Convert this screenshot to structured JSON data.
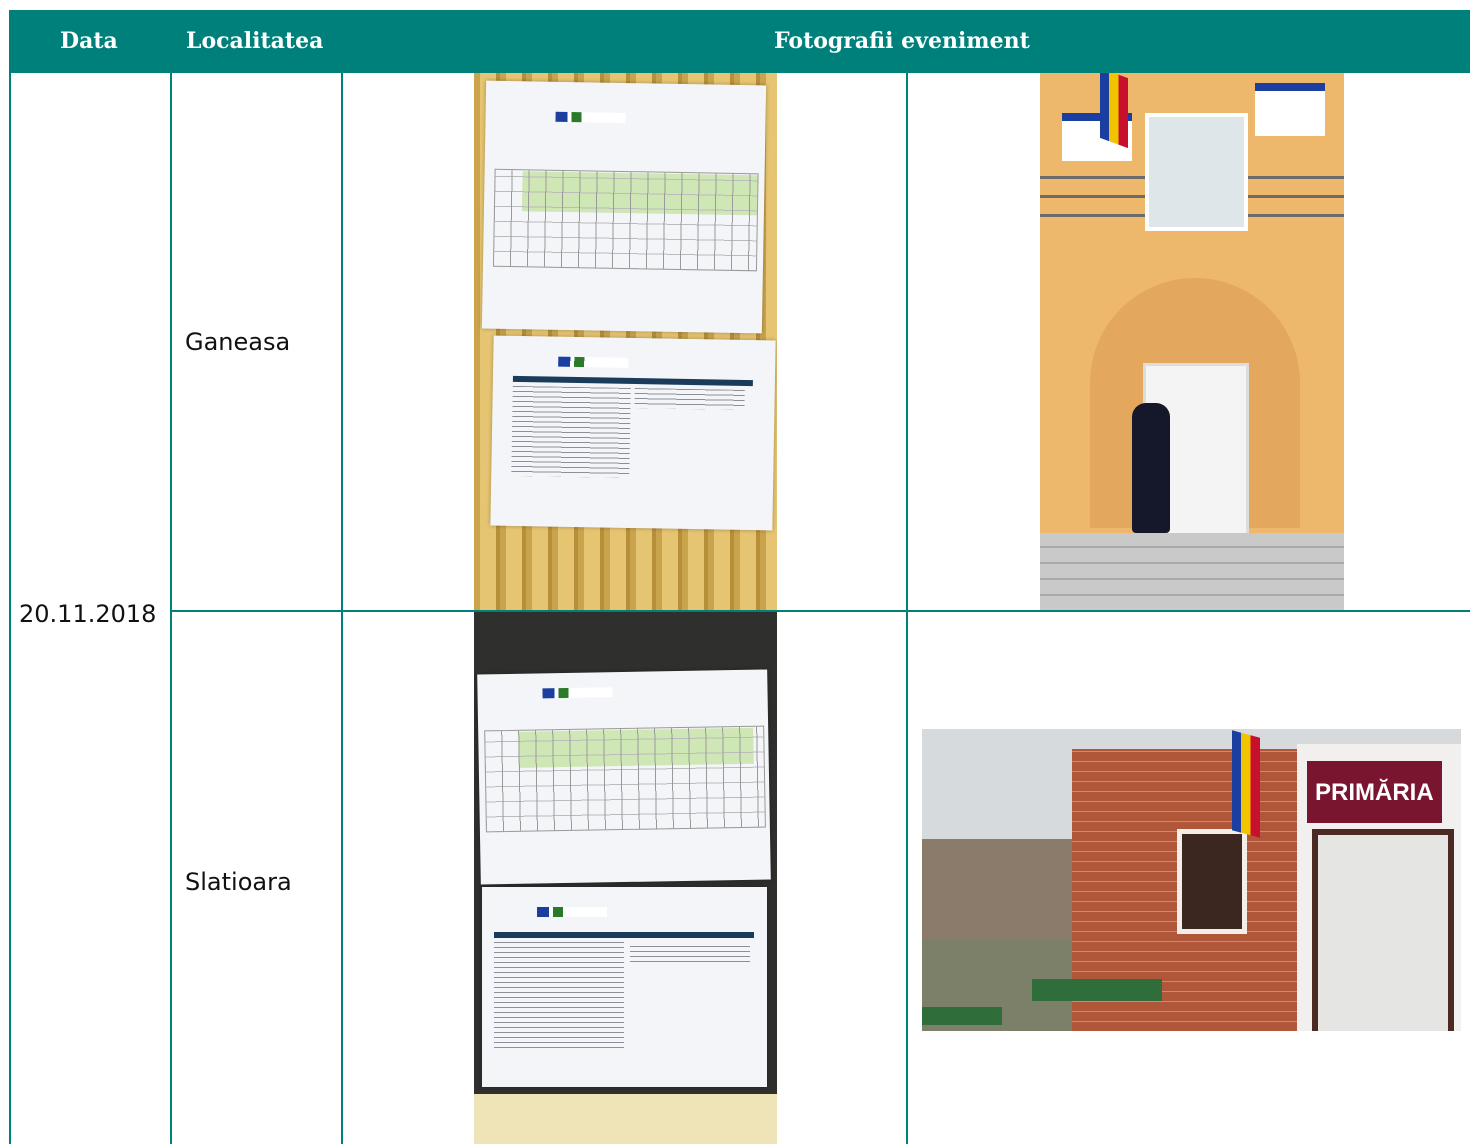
{
  "table": {
    "headers": [
      "Data",
      "Localitatea",
      "Fotografii eveniment"
    ],
    "date": "20.11.2018",
    "rows": [
      {
        "locality": "Ganeasa"
      },
      {
        "locality": "Slatioara"
      }
    ]
  },
  "signs": {
    "primaria": "PRIMĂRIA"
  },
  "colors": {
    "header_bg": "#00807b",
    "header_text": "#ffffff",
    "border": "#00807b"
  }
}
